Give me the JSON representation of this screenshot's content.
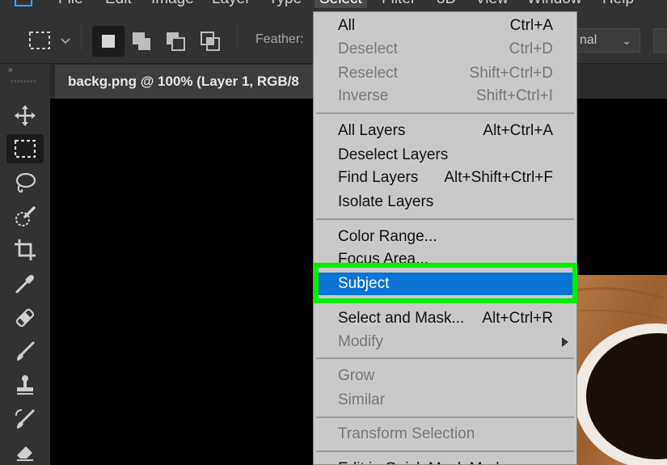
{
  "menubar": {
    "items": [
      {
        "label": "File"
      },
      {
        "label": "Edit"
      },
      {
        "label": "Image"
      },
      {
        "label": "Layer"
      },
      {
        "label": "Type"
      },
      {
        "label": "Select"
      },
      {
        "label": "Filter"
      },
      {
        "label": "3D"
      },
      {
        "label": "View"
      },
      {
        "label": "Window"
      },
      {
        "label": "Help"
      }
    ]
  },
  "options": {
    "feather_label": "Feather:",
    "blend_value": "nal",
    "icons": [
      "marquee-rect-icon",
      "new-selection-icon",
      "add-selection-icon",
      "subtract-selection-icon",
      "intersect-selection-icon"
    ]
  },
  "toolbar": {
    "grip": "»",
    "tools": [
      "move-icon",
      "rectangular-marquee-icon",
      "lasso-icon",
      "quick-selection-icon",
      "crop-icon",
      "eyedropper-icon",
      "healing-brush-icon",
      "brush-icon",
      "clone-stamp-icon",
      "history-brush-icon",
      "eraser-icon"
    ]
  },
  "document": {
    "tab_title": "backg.png @ 100% (Layer 1, RGB/8"
  },
  "select_menu": {
    "groups": [
      [
        {
          "label": "All",
          "shortcut": "Ctrl+A",
          "enabled": true
        },
        {
          "label": "Deselect",
          "shortcut": "Ctrl+D",
          "enabled": false
        },
        {
          "label": "Reselect",
          "shortcut": "Shift+Ctrl+D",
          "enabled": false
        },
        {
          "label": "Inverse",
          "shortcut": "Shift+Ctrl+I",
          "enabled": false
        }
      ],
      [
        {
          "label": "All Layers",
          "shortcut": "Alt+Ctrl+A",
          "enabled": true
        },
        {
          "label": "Deselect Layers",
          "shortcut": "",
          "enabled": true
        },
        {
          "label": "Find Layers",
          "shortcut": "Alt+Shift+Ctrl+F",
          "enabled": true
        },
        {
          "label": "Isolate Layers",
          "shortcut": "",
          "enabled": true
        }
      ],
      [
        {
          "label": "Color Range...",
          "shortcut": "",
          "enabled": true
        },
        {
          "label": "Focus Area...",
          "shortcut": "",
          "enabled": true
        },
        {
          "label": "Subject",
          "shortcut": "",
          "enabled": true,
          "highlighted": true
        }
      ],
      [
        {
          "label": "Select and Mask...",
          "shortcut": "Alt+Ctrl+R",
          "enabled": true
        },
        {
          "label": "Modify",
          "shortcut": "",
          "enabled": false,
          "submenu": true
        }
      ],
      [
        {
          "label": "Grow",
          "shortcut": "",
          "enabled": false
        },
        {
          "label": "Similar",
          "shortcut": "",
          "enabled": false
        }
      ],
      [
        {
          "label": "Transform Selection",
          "shortcut": "",
          "enabled": false
        }
      ],
      [
        {
          "label": "Edit in Quick Mask Mode",
          "shortcut": "",
          "enabled": true
        }
      ]
    ]
  },
  "colors": {
    "highlight_border": "#00ee00",
    "hover_fill": "#0b73d6",
    "menu_bg": "#c9c9c9",
    "app_bg": "#323232"
  }
}
